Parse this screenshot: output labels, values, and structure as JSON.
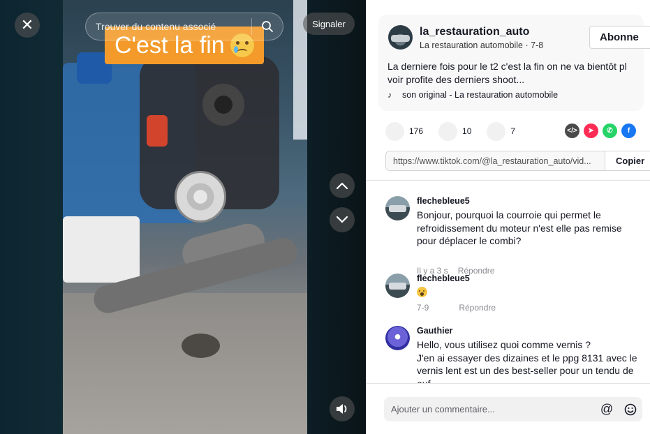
{
  "video": {
    "caption_text": "C'est la fin",
    "close_label": "✕",
    "search_placeholder": "Trouver du contenu associé",
    "report_label": "Signaler"
  },
  "author": {
    "username": "la_restauration_auto",
    "subtitle": "La restauration automobile · 7-8",
    "follow_label": "Abonne",
    "description": "La derniere fois pour le t2 c'est la fin on ne va bientôt pl\nvoir profite des derniers shoot...",
    "music": "son original - La restauration automobile"
  },
  "stats": {
    "likes": "176",
    "comments": "10",
    "saves": "7"
  },
  "share": {
    "icons": [
      "embed-icon",
      "send-icon",
      "whatsapp-icon",
      "facebook-icon"
    ],
    "embed_color": "#4a4a4a",
    "send_color": "#fe2c55",
    "whatsapp_color": "#25d366",
    "facebook_color": "#1877f2"
  },
  "link": {
    "url": "https://www.tiktok.com/@la_restauration_auto/vid...",
    "copy_label": "Copier"
  },
  "comments": [
    {
      "user": "flechebleue5",
      "text": "Bonjour, pourquoi la courroie qui permet le refroidissement du moteur n'est elle pas remise pour déplacer le combi?",
      "time": "Il y a 3 s",
      "reply": "Répondre"
    },
    {
      "user": "flechebleue5",
      "text": "",
      "time": "7-9",
      "reply": "Répondre"
    },
    {
      "user": "Gauthier",
      "text": "Hello, vous utilisez quoi comme vernis ?\nJ'en ai essayer des dizaines et le ppg 8131 avec le vernis lent est un des best-seller pour un tendu de ouf",
      "time": "",
      "reply": ""
    }
  ],
  "comment_bar": {
    "placeholder": "Ajouter un commentaire...",
    "mention_label": "@"
  }
}
